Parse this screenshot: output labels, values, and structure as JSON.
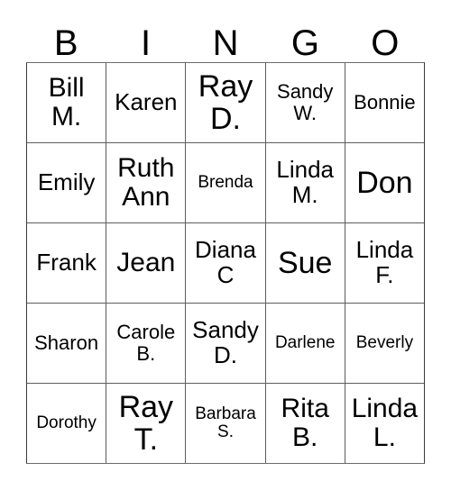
{
  "card": {
    "headers": [
      "B",
      "I",
      "N",
      "G",
      "O"
    ],
    "rows": [
      [
        {
          "name": "Bill\nM.",
          "size": "fs-lg"
        },
        {
          "name": "Karen",
          "size": "fs-md"
        },
        {
          "name": "Ray\nD.",
          "size": "fs-xl"
        },
        {
          "name": "Sandy\nW.",
          "size": "fs-sm"
        },
        {
          "name": "Bonnie",
          "size": "fs-sm"
        }
      ],
      [
        {
          "name": "Emily",
          "size": "fs-md"
        },
        {
          "name": "Ruth\nAnn",
          "size": "fs-lg"
        },
        {
          "name": "Brenda",
          "size": "fs-xs"
        },
        {
          "name": "Linda\nM.",
          "size": "fs-md"
        },
        {
          "name": "Don",
          "size": "fs-xl"
        }
      ],
      [
        {
          "name": "Frank",
          "size": "fs-md"
        },
        {
          "name": "Jean",
          "size": "fs-lg"
        },
        {
          "name": "Diana\nC",
          "size": "fs-md"
        },
        {
          "name": "Sue",
          "size": "fs-xl"
        },
        {
          "name": "Linda\nF.",
          "size": "fs-md"
        }
      ],
      [
        {
          "name": "Sharon",
          "size": "fs-sm"
        },
        {
          "name": "Carole\nB.",
          "size": "fs-sm"
        },
        {
          "name": "Sandy\nD.",
          "size": "fs-md"
        },
        {
          "name": "Darlene",
          "size": "fs-xs"
        },
        {
          "name": "Beverly",
          "size": "fs-xs"
        }
      ],
      [
        {
          "name": "Dorothy",
          "size": "fs-xs"
        },
        {
          "name": "Ray\nT.",
          "size": "fs-xl"
        },
        {
          "name": "Barbara\nS.",
          "size": "fs-xs"
        },
        {
          "name": "Rita\nB.",
          "size": "fs-lg"
        },
        {
          "name": "Linda\nL.",
          "size": "fs-lg"
        }
      ]
    ]
  },
  "colors": {
    "background": "#ffffff",
    "text": "#000000",
    "grid_line": "#5e5e5e"
  }
}
